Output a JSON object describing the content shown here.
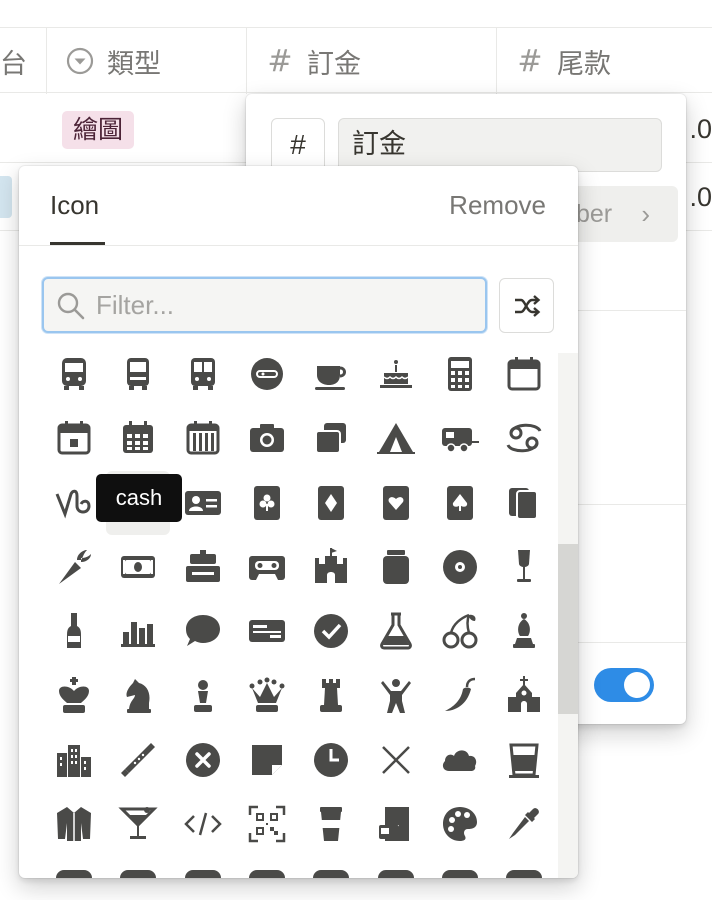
{
  "table": {
    "columns": [
      {
        "label": "台",
        "icon": "text-icon"
      },
      {
        "label": "類型",
        "icon": "select-icon"
      },
      {
        "label": "訂金",
        "icon": "number-icon"
      },
      {
        "label": "尾款",
        "icon": "number-icon"
      }
    ],
    "tag": "繪圖",
    "right_values": [
      ".0",
      ".0"
    ]
  },
  "property_panel": {
    "type_symbol": "#",
    "name_value": "訂金",
    "format_label": "ber",
    "toggle_on": true,
    "toggle_color": "#2e8ce6"
  },
  "icon_picker": {
    "tab_label": "Icon",
    "remove_label": "Remove",
    "filter_placeholder": "Filter...",
    "tooltip": "cash",
    "hovered_icon": "cash",
    "icons": [
      [
        "bus-front-icon",
        "bus-icon",
        "tram-icon",
        "ticket-icon",
        "coffee-cup-icon",
        "cake-icon",
        "calculator-icon",
        "calendar-icon"
      ],
      [
        "calendar-day-icon",
        "calendar-grid-icon",
        "calendar-week-icon",
        "camera-icon",
        "cards-icon",
        "tent-icon",
        "camper-van-icon",
        "cancer-sign-icon"
      ],
      [
        "capricorn-sign-icon",
        "cash-icon",
        "id-card-icon",
        "card-club-icon",
        "card-diamond-icon",
        "card-heart-icon",
        "card-spade-icon",
        "cards-stack-icon"
      ],
      [
        "carrot-icon",
        "cash-register-icon",
        "cash-register-bell-icon",
        "cassette-icon",
        "castle-icon",
        "jar-icon",
        "cd-icon",
        "champagne-glass-icon"
      ],
      [
        "champagne-bottle-icon",
        "bar-chart-icon",
        "chat-bubble-icon",
        "checkbook-icon",
        "check-circle-icon",
        "flask-icon",
        "cherries-icon",
        "chess-bishop-icon"
      ],
      [
        "chess-king-icon",
        "chess-knight-icon",
        "chess-pawn-icon",
        "chess-queen-icon",
        "chess-rook-icon",
        "child-icon",
        "chili-pepper-icon",
        "church-icon"
      ],
      [
        "city-icon",
        "clarinet-icon",
        "clear-icon",
        "sticky-note-icon",
        "clock-icon",
        "close-icon",
        "cloud-icon",
        "drinking-glass-icon"
      ],
      [
        "coat-icon",
        "cocktail-icon",
        "code-icon",
        "qr-code-icon",
        "coffee-to-go-icon",
        "coffee-maker-icon",
        "palette-icon",
        "eyedropper-icon"
      ]
    ]
  }
}
